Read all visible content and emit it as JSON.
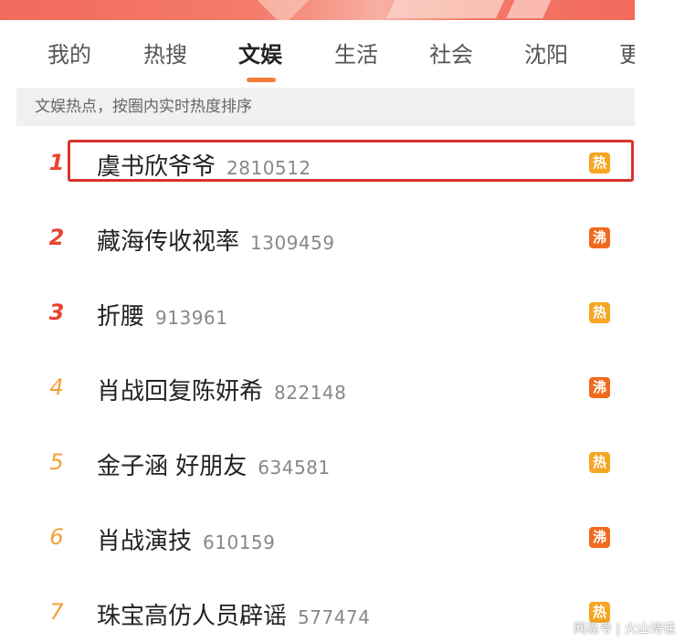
{
  "tabs": [
    {
      "label": "我的"
    },
    {
      "label": "热搜"
    },
    {
      "label": "文娱"
    },
    {
      "label": "生活"
    },
    {
      "label": "社会"
    },
    {
      "label": "沈阳"
    },
    {
      "label": "更"
    }
  ],
  "active_tab": "文娱",
  "subheader": "文娱热点，按圈内实时热度排序",
  "items": [
    {
      "rank": "1",
      "title": "虞书欣爷爷",
      "count": "2810512",
      "badge": "热"
    },
    {
      "rank": "2",
      "title": "藏海传收视率",
      "count": "1309459",
      "badge": "沸"
    },
    {
      "rank": "3",
      "title": "折腰",
      "count": "913961",
      "badge": "热"
    },
    {
      "rank": "4",
      "title": "肖战回复陈妍希",
      "count": "822148",
      "badge": "沸"
    },
    {
      "rank": "5",
      "title": "金子涵 好朋友",
      "count": "634581",
      "badge": "热"
    },
    {
      "rank": "6",
      "title": "肖战演技",
      "count": "610159",
      "badge": "沸"
    },
    {
      "rank": "7",
      "title": "珠宝高仿人员辟谣",
      "count": "577474",
      "badge": "热"
    }
  ],
  "colors": {
    "accent": "#f37e3a",
    "rank_top": "#e8432f",
    "rank_other": "#f2a13a",
    "badge_hot": "#f5a623",
    "badge_boil": "#f06a1e",
    "highlight_box": "#d8322a"
  },
  "watermark": "网易号 | 火山诗话"
}
